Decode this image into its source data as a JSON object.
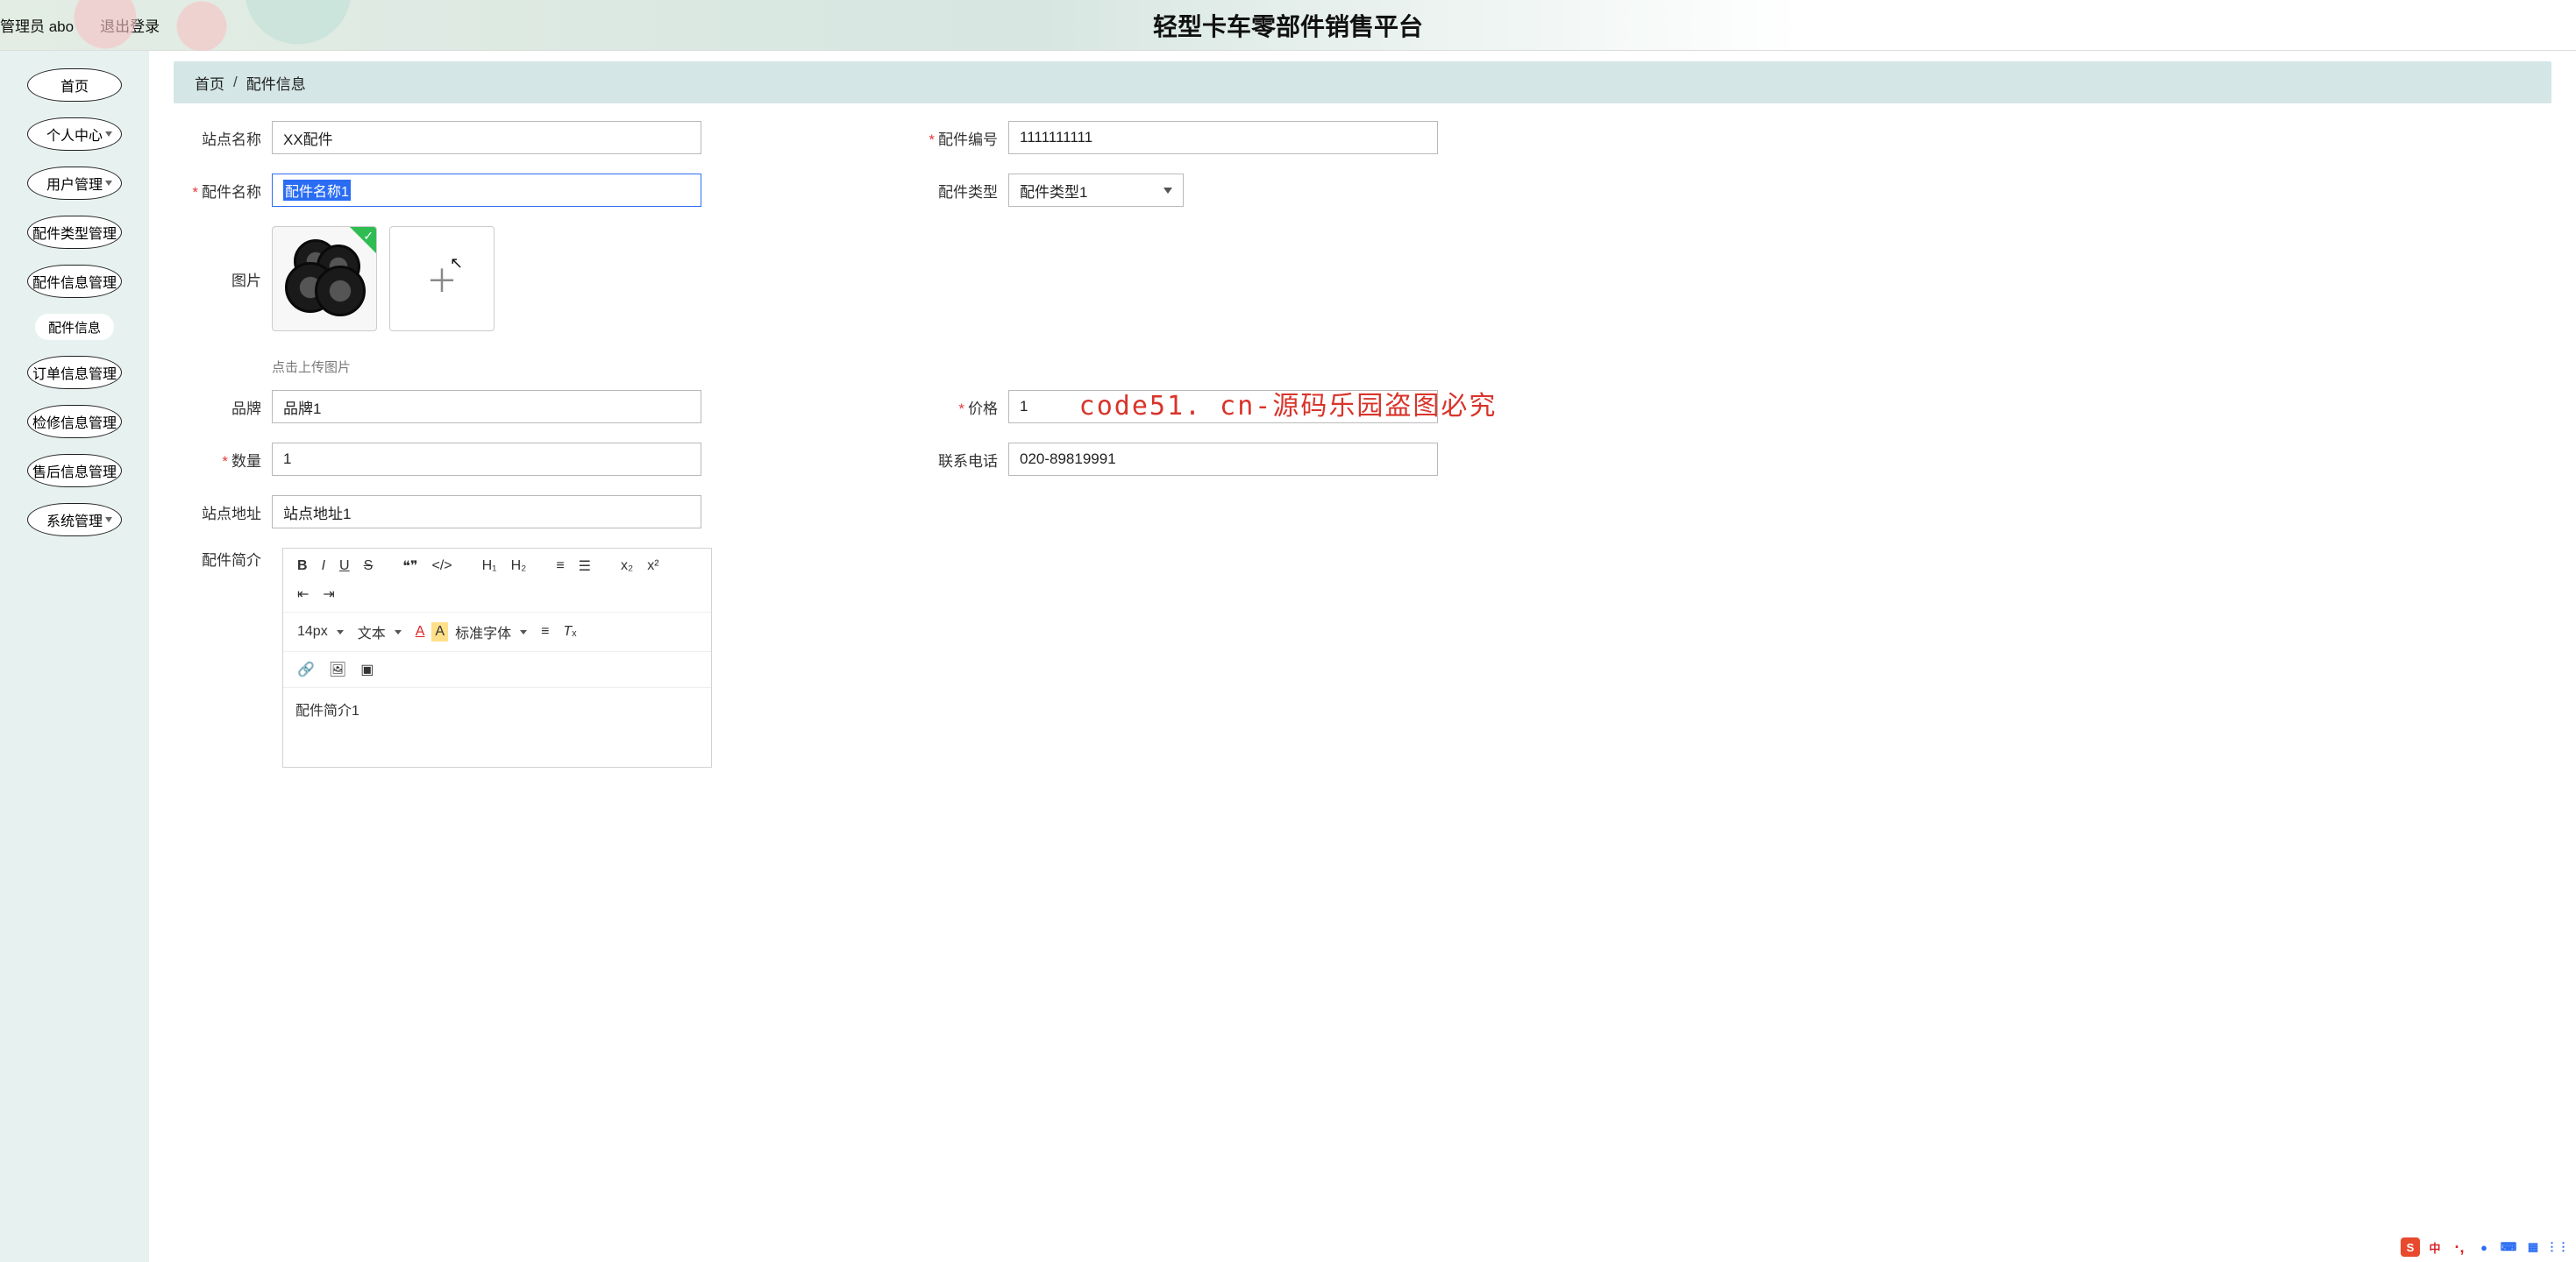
{
  "header": {
    "title": "轻型卡车零部件销售平台",
    "admin_label": "管理员 abo",
    "logout": "退出登录"
  },
  "sidebar": {
    "items": [
      {
        "label": "首页",
        "sub": false
      },
      {
        "label": "个人中心",
        "sub": true
      },
      {
        "label": "用户管理",
        "sub": true
      },
      {
        "label": "配件类型管理",
        "sub": false
      },
      {
        "label": "配件信息管理",
        "sub": false
      },
      {
        "label": "订单信息管理",
        "sub": false
      },
      {
        "label": "检修信息管理",
        "sub": false
      },
      {
        "label": "售后信息管理",
        "sub": false
      },
      {
        "label": "系统管理",
        "sub": true
      }
    ],
    "sub_item": "配件信息"
  },
  "breadcrumb": {
    "home": "首页",
    "current": "配件信息"
  },
  "form": {
    "site_name": {
      "label": "站点名称",
      "value": "XX配件"
    },
    "part_no": {
      "label": "配件编号",
      "value": "1111111111",
      "required": true
    },
    "part_name": {
      "label": "配件名称",
      "value": "配件名称1",
      "required": true
    },
    "part_type": {
      "label": "配件类型",
      "value": "配件类型1"
    },
    "image": {
      "label": "图片"
    },
    "upload_hint": "点击上传图片",
    "brand": {
      "label": "品牌",
      "value": "品牌1"
    },
    "price": {
      "label": "价格",
      "value": "1",
      "required": true
    },
    "qty": {
      "label": "数量",
      "value": "1",
      "required": true
    },
    "phone": {
      "label": "联系电话",
      "value": "020-89819991"
    },
    "site_addr": {
      "label": "站点地址",
      "value": "站点地址1"
    },
    "intro": {
      "label": "配件简介",
      "value": "配件简介1"
    }
  },
  "editor_toolbar": {
    "font_size": "14px",
    "block": "文本",
    "font_family": "标准字体"
  },
  "watermark_text": "code51.cn",
  "center_watermark": "code51. cn-源码乐园盗图必究"
}
